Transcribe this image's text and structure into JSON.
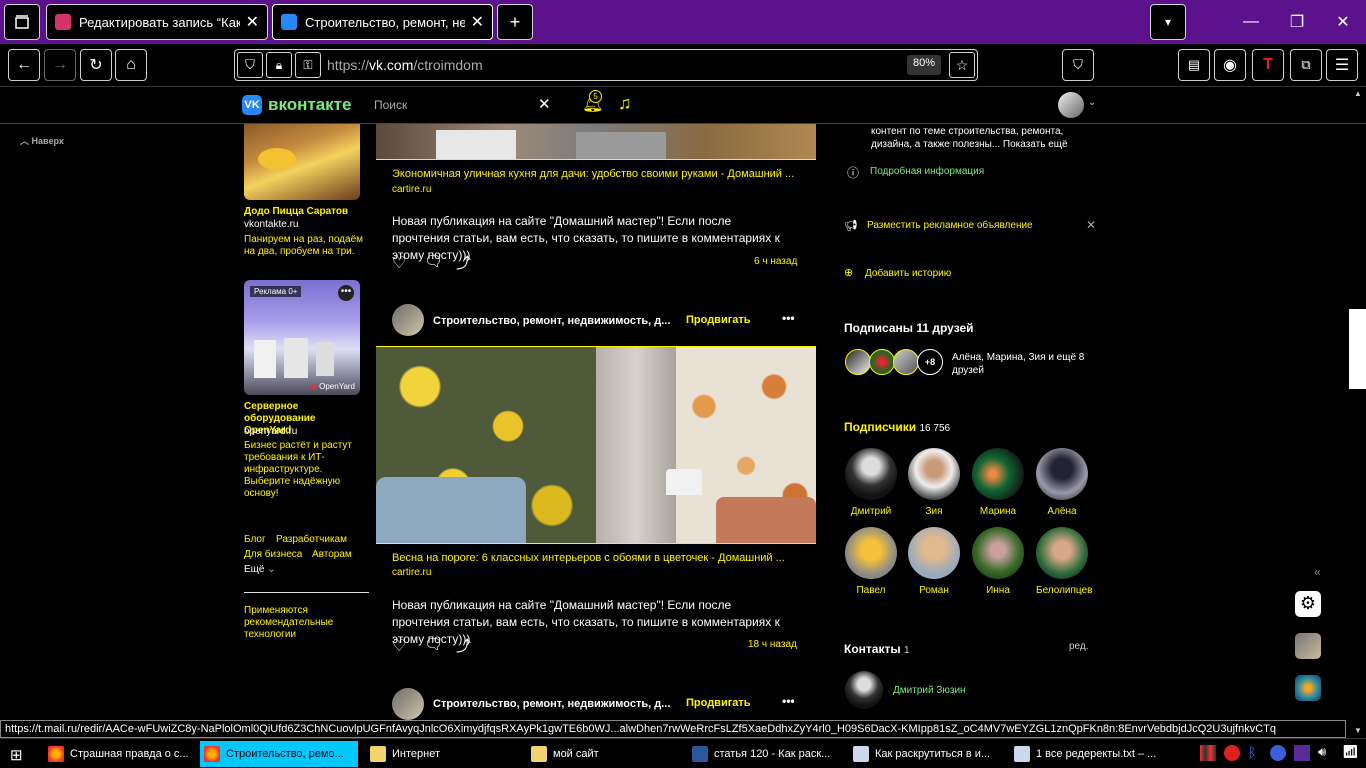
{
  "tabs": [
    {
      "title": "Редактировать запись “Как ра"
    },
    {
      "title": "Строительство, ремонт, недв"
    }
  ],
  "nav": {
    "url_prefix": "https://",
    "url_host": "vk.com",
    "url_path": "/ctroimdom",
    "zoom": "80%"
  },
  "vk": {
    "logo": "вконтакте",
    "search_placeholder": "Поиск",
    "notif_count": "5",
    "back_to_top": "Наверх"
  },
  "left_ads": [
    {
      "title": "Додо Пицца Саратов",
      "domain": "vkontakte.ru",
      "text": "Панируем на раз, подаём на два, пробуем на три."
    },
    {
      "label": "Реклама 0+",
      "brand": "OpenYard",
      "title": "Серверное оборудование OpenYard",
      "domain": "openyard.ru",
      "text": "Бизнес растёт и растут требования к ИТ-инфраструктуре. Выберите надёжную основу!"
    }
  ],
  "footer_links": {
    "blog": "Блог",
    "dev": "Разработчикам",
    "biz": "Для бизнеса",
    "authors": "Авторам",
    "more": "Ещё",
    "recommend": "Применяются рекомендательные технологии"
  },
  "posts": [
    {
      "link_title": "Экономичная уличная кухня для дачи: удобство своими руками - Домашний ...",
      "domain": "cartire.ru",
      "text": "Новая публикация на сайте \"Домашний мастер\"! Если после прочтения статьи, вам есть, что сказать, то пишите в комментариях к этому посту)))",
      "time": "6 ч назад"
    },
    {
      "author": "Строительство, ремонт, недвижимость, д...",
      "promote": "Продвигать",
      "link_title": "Весна на пороге: 6 классных интерьеров с обоями в цветочек - Домашний ...",
      "domain": "cartire.ru",
      "text": "Новая публикация на сайте \"Домашний мастер\"! Если после прочтения статьи, вам есть, что сказать, то пишите в комментариях к этому посту)))",
      "time": "18 ч назад"
    },
    {
      "author": "Строительство, ремонт, недвижимость, д...",
      "promote": "Продвигать"
    }
  ],
  "right": {
    "desc": "контент по теме строительства, ремонта, дизайна, а также полезны... Показать ещё",
    "more_info": "Подробная информация",
    "ad_place": "Разместить рекламное объявление",
    "add_story": "Добавить историю",
    "friends_title": "Подписаны 11 друзей",
    "friends_plus": "+8",
    "friends_text": "Алёна, Марина, Зия и ещё 8 друзей",
    "subs_title": "Подписчики",
    "subs_count": "16 756",
    "subscribers": [
      {
        "name": "Дмитрий"
      },
      {
        "name": "Зия"
      },
      {
        "name": "Марина"
      },
      {
        "name": "Алёна"
      },
      {
        "name": "Павел"
      },
      {
        "name": "Роман"
      },
      {
        "name": "Инна"
      },
      {
        "name": "Белолипцев"
      }
    ],
    "contacts_title": "Контакты",
    "contacts_count": "1",
    "contacts_edit": "ред.",
    "contact_name": "Дмитрий Зюзин"
  },
  "status_url": "https://t.mail.ru/redir/AACe-wFUwiZC8y-NaPlolOml0QiUfd6Z3ChNCuovlpUGFnfAvyqJnlcO6XimydjfqsRXAyPk1gwTE6b0WJ...alwDhen7rwWeRrcFsLZf5XaeDdhxZyY4rl0_H09S6DacX-KMIpp81sZ_oC4MV7wEYZGL1znQpFKn8n:8EnvrVebdbjdJcQ2U3ujfnkvCTq",
  "taskbar": [
    {
      "label": "Страшная правда о с..."
    },
    {
      "label": "Строительство, ремо..."
    },
    {
      "label": "Интернет"
    },
    {
      "label": "мой сайт"
    },
    {
      "label": "статья 120 - Как раск..."
    },
    {
      "label": "Как раскрутиться в и..."
    },
    {
      "label": "1 все редеректы.txt – ..."
    }
  ],
  "colors": {
    "accent": "#fff200",
    "link_green": "#7dea7d",
    "tabbar": "#5b128c",
    "taskbar_active": "#00c8ff"
  }
}
